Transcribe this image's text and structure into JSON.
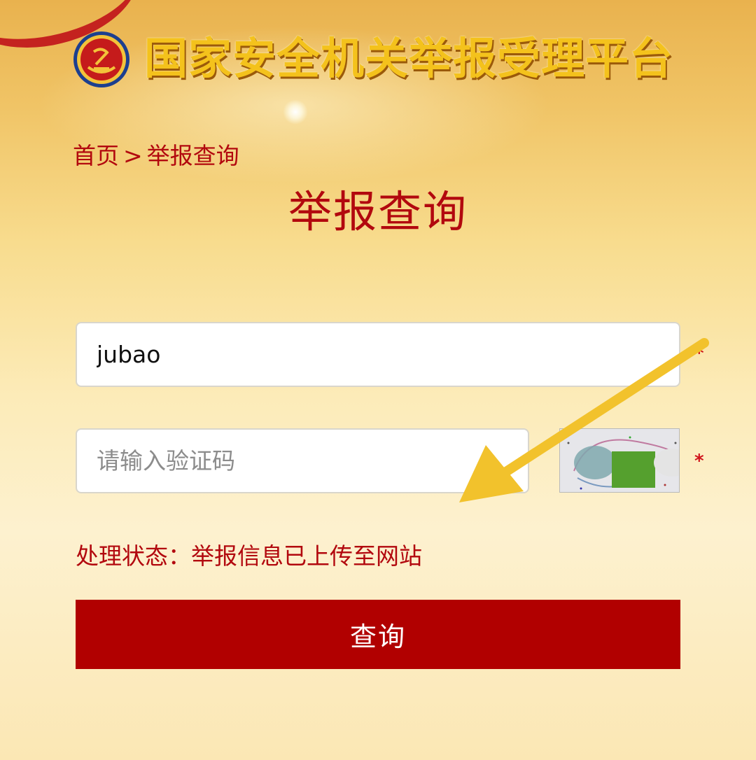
{
  "header": {
    "site_title": "国家安全机关举报受理平台",
    "emblem_icon": "national-security-emblem-icon"
  },
  "breadcrumb": {
    "home": "首页",
    "separator": ">",
    "current": "举报查询"
  },
  "page_title": "举报查询",
  "form": {
    "report_id_value": "jubao",
    "report_id_required_mark": "*",
    "captcha_placeholder": "请输入验证码",
    "captcha_required_mark": "*",
    "captcha_image_icon": "captcha-image"
  },
  "status": {
    "label": "处理状态：",
    "value": "举报信息已上传至网站"
  },
  "submit_label": "查询",
  "colors": {
    "accent_red": "#b10000",
    "text_red": "#b2080e",
    "title_gold": "#f4c21c",
    "annotation_arrow": "#f2c22c"
  }
}
